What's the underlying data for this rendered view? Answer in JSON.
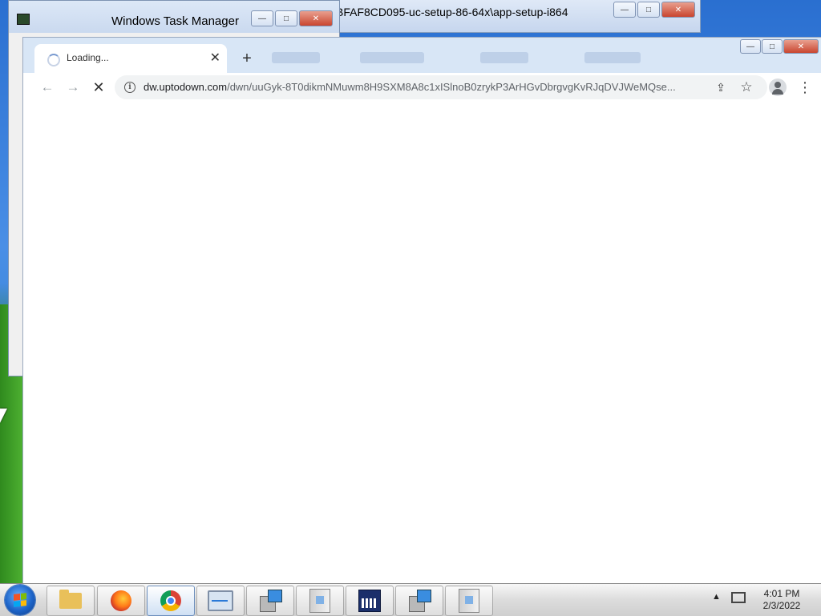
{
  "back_window": {
    "title": "BFAF8CD095-uc-setup-86-64x\\app-setup-i864",
    "buttons": {
      "minimize": "—",
      "maximize": "□",
      "close": "✕"
    }
  },
  "task_manager": {
    "title": "Windows Task Manager",
    "buttons": {
      "minimize": "—",
      "maximize": "□",
      "close": "✕"
    }
  },
  "chrome": {
    "frame_buttons": {
      "minimize": "—",
      "maximize": "□",
      "close": "✕"
    },
    "active_tab": {
      "title": "Loading...",
      "close": "✕"
    },
    "new_tab": "+",
    "toolbar": {
      "back": "←",
      "forward": "→",
      "stop": "✕",
      "url_host": "dw.uptodown.com",
      "url_path": "/dwn/uuGyk-8T0dikmNMuwm8H9SXM8A8c1xISlnoB0zrykP3ArHGvDbrgvgKvRJqDVJWeMQse...",
      "info_icon": "i",
      "share_icon": "⇪",
      "star_icon": "☆",
      "menu_icon": "⋮"
    }
  },
  "taskbar": {
    "items": [
      {
        "name": "explorer-taskbar-icon"
      },
      {
        "name": "firefox-taskbar-icon"
      },
      {
        "name": "chrome-taskbar-icon"
      },
      {
        "name": "task-manager-taskbar-icon"
      },
      {
        "name": "installer-taskbar-icon"
      },
      {
        "name": "setup-package-taskbar-icon"
      },
      {
        "name": "command-prompt-taskbar-icon"
      },
      {
        "name": "installer-taskbar-icon"
      },
      {
        "name": "setup-package-taskbar-icon"
      }
    ],
    "tray_arrow": "▲",
    "clock": {
      "time": "4:01 PM",
      "date": "2/3/2022"
    }
  }
}
